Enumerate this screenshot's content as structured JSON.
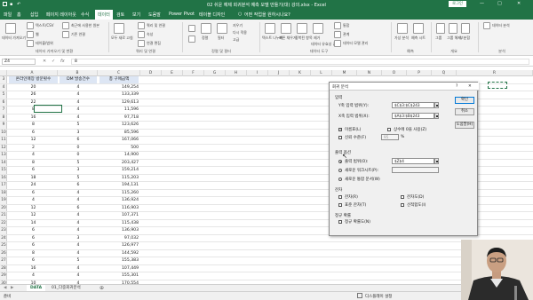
{
  "window": {
    "title": "02 쉬운 예제 회귀분석 예측 모델 만들기(대) 강의.xlsx - Excel",
    "signin": "로그인",
    "controls": [
      "—",
      "□",
      "✕"
    ]
  },
  "ribbon_tabs": [
    "파일",
    "홈",
    "삽입",
    "페이지 레이아웃",
    "수식",
    "데이터",
    "검토",
    "보기",
    "도움말",
    "Power Pivot",
    "테이블 디자인",
    "어떤 작업을 원하시나요?"
  ],
  "active_tab": "데이터",
  "ribbon_groups": [
    "데이터 가져오기 및 변환",
    "쿼리 및 연결",
    "정렬 및 필터",
    "데이터 도구",
    "예측",
    "개요",
    "분석"
  ],
  "ribbon_labels": {
    "get_data": "데이터 가져오기",
    "from_text": "텍스트/CSV",
    "from_web": "웹",
    "from_table": "테이블/범위",
    "recent_sources": "최근에 사용한 원본",
    "existing_connections": "기존 연결",
    "refresh_all": "모두 새로 고침",
    "queries": "쿼리 및 연결",
    "properties": "속성",
    "edit_links": "연결 편집",
    "sort": "정렬",
    "filter": "필터",
    "clear": "지우기",
    "reapply": "다시 적용",
    "advanced": "고급",
    "text_to_columns": "텍스트 나누기",
    "flash_fill": "빠른 채우기",
    "remove_duplicates": "중복된 항목 제거",
    "data_validation": "데이터 유효성 검사",
    "consolidate": "통합",
    "relationships": "관계",
    "data_model": "데이터 모델 관리",
    "what_if": "가상 분석",
    "forecast_sheet": "예측 시트",
    "group": "그룹",
    "ungroup": "그룹 해제",
    "subtotal": "부분합",
    "data_analysis": "데이터 분석"
  },
  "name_box": "Z4",
  "formula": "8",
  "columns": [
    "A",
    "B",
    "C",
    "D",
    "E",
    "F",
    "G",
    "H",
    "I",
    "J",
    "K",
    "L",
    "M",
    "N",
    "O",
    "P",
    "Q",
    "R"
  ],
  "header_row": {
    "col_a": "온라인매장 방문횟수",
    "col_b": "DM 발송건수",
    "col_c": "총 구매금액"
  },
  "rows": [
    {
      "n": "4",
      "a": "20",
      "b": "4",
      "c": "149,254"
    },
    {
      "n": "5",
      "a": "26",
      "b": "4",
      "c": "133,339"
    },
    {
      "n": "6",
      "a": "22",
      "b": "4",
      "c": "129,613"
    },
    {
      "n": "7",
      "a": "8",
      "b": "4",
      "c": "11,596"
    },
    {
      "n": "8",
      "a": "16",
      "b": "4",
      "c": "97,718"
    },
    {
      "n": "9",
      "a": "8",
      "b": "5",
      "c": "123,626"
    },
    {
      "n": "10",
      "a": "6",
      "b": "3",
      "c": "85,596"
    },
    {
      "n": "11",
      "a": "12",
      "b": "6",
      "c": "167,066"
    },
    {
      "n": "12",
      "a": "2",
      "b": "0",
      "c": "500"
    },
    {
      "n": "13",
      "a": "4",
      "b": "0",
      "c": "14,900"
    },
    {
      "n": "14",
      "a": "8",
      "b": "5",
      "c": "203,427"
    },
    {
      "n": "15",
      "a": "6",
      "b": "3",
      "c": "159,214"
    },
    {
      "n": "16",
      "a": "18",
      "b": "5",
      "c": "115,203"
    },
    {
      "n": "17",
      "a": "24",
      "b": "6",
      "c": "194,131"
    },
    {
      "n": "18",
      "a": "6",
      "b": "4",
      "c": "115,260"
    },
    {
      "n": "19",
      "a": "4",
      "b": "4",
      "c": "136,924"
    },
    {
      "n": "20",
      "a": "12",
      "b": "6",
      "c": "116,903"
    },
    {
      "n": "21",
      "a": "12",
      "b": "4",
      "c": "107,371"
    },
    {
      "n": "22",
      "a": "14",
      "b": "4",
      "c": "115,438"
    },
    {
      "n": "23",
      "a": "6",
      "b": "4",
      "c": "136,903"
    },
    {
      "n": "24",
      "a": "6",
      "b": "3",
      "c": "97,032"
    },
    {
      "n": "25",
      "a": "6",
      "b": "4",
      "c": "126,977"
    },
    {
      "n": "26",
      "a": "8",
      "b": "4",
      "c": "144,592"
    },
    {
      "n": "27",
      "a": "6",
      "b": "5",
      "c": "155,383"
    },
    {
      "n": "28",
      "a": "16",
      "b": "4",
      "c": "107,449"
    },
    {
      "n": "29",
      "a": "4",
      "b": "4",
      "c": "155,301"
    },
    {
      "n": "30",
      "a": "10",
      "b": "4",
      "c": "170,554"
    }
  ],
  "dialog": {
    "title": "회귀 분석",
    "help": "?",
    "close": "✕",
    "input_label": "입력",
    "y_label": "Y축 입력 범위(Y):",
    "y_value": "$C$3:$C$243",
    "x_label": "X축 입력 범위(X):",
    "x_value": "$A$3:$B$243",
    "labels": "이름표(L)",
    "constant_zero": "상수에 0을 사용(Z)",
    "confidence": "신뢰 수준(F)",
    "confidence_value": "95",
    "percent": "%",
    "output_label": "출력 옵션",
    "output_range": "출력 범위(O):",
    "output_value": "$Z$4",
    "new_sheet": "새로운 워크시트(P):",
    "new_workbook": "새로운 통합 문서(W)",
    "residuals_label": "잔차",
    "residuals": "잔차(R)",
    "std_residuals": "표준 잔차(T)",
    "residual_plots": "잔차도(D)",
    "line_fit": "선적합도(I)",
    "normal_label": "정규 확률",
    "normal_plot": "정규 확률도(N)",
    "ok": "확인",
    "cancel": "취소",
    "help_button": "도움말(H)"
  },
  "sheets": [
    "DATA",
    "01_다중회귀분석"
  ],
  "active_sheet": "DATA",
  "status": {
    "mode": "준비",
    "display": "디스플레이 설정",
    "zoom": "100%"
  },
  "colors": {
    "excel_green": "#217346",
    "dialog_bg": "#f0f0f0"
  }
}
